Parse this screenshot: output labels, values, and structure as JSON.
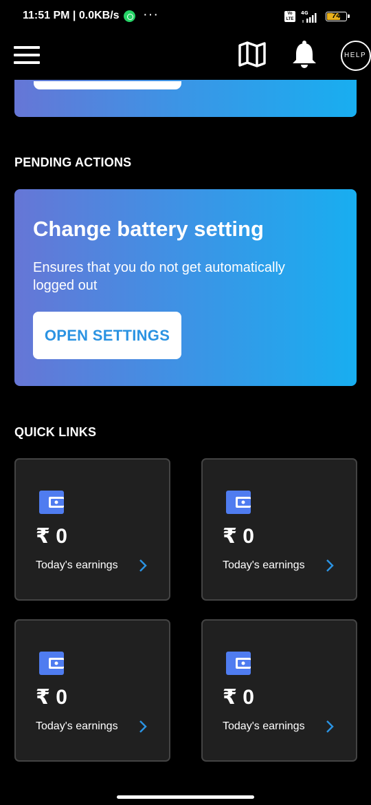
{
  "status_bar": {
    "time_speed": "11:51 PM | 0.0KB/s",
    "more": "···",
    "volte": "Vo LTE",
    "network": "4G",
    "battery_percent": "74",
    "battery_level": 0.74
  },
  "app_bar": {
    "help_label": "HELP"
  },
  "pending": {
    "section_title": "PENDING ACTIONS",
    "card_title": "Change battery setting",
    "card_description": "Ensures that you do not get automatically logged out",
    "button_label": "OPEN SETTINGS"
  },
  "quick_links": {
    "section_title": "QUICK LINKS",
    "tiles": [
      {
        "amount": "₹ 0",
        "label": "Today's earnings"
      },
      {
        "amount": "₹ 0",
        "label": "Today's earnings"
      },
      {
        "amount": "₹ 0",
        "label": "Today's earnings"
      },
      {
        "amount": "₹ 0",
        "label": "Today's earnings"
      }
    ]
  },
  "colors": {
    "accent_blue": "#2b93e2",
    "wallet_blue": "#4f7cf0",
    "gradient_start": "#6676d6",
    "gradient_end": "#18aef0"
  }
}
